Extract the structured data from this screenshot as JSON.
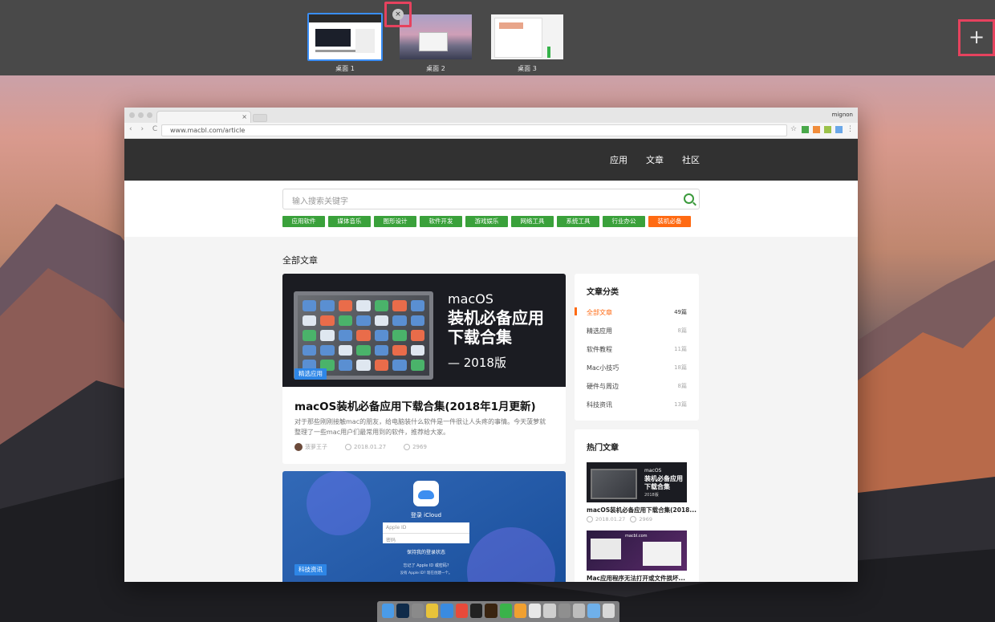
{
  "spaces": [
    {
      "label": "桌面 1",
      "active": true
    },
    {
      "label": "桌面 2",
      "active": false
    },
    {
      "label": "桌面 3",
      "active": false
    }
  ],
  "spaces_add": "+",
  "spaces_close": "×",
  "browser": {
    "tab_title": "",
    "tab_close": "×",
    "user_name": "mignon",
    "nav_buttons": "‹ › C",
    "url": "www.macbl.com/article"
  },
  "site_nav": [
    "应用",
    "文章",
    "社区"
  ],
  "search": {
    "placeholder": "输入搜索关键字"
  },
  "categories": [
    "应用软件",
    "媒体音乐",
    "图形设计",
    "软件开发",
    "游戏娱乐",
    "网络工具",
    "系统工具",
    "行业办公",
    "装机必备"
  ],
  "section_heading": "全部文章",
  "article": {
    "hero_line1": "macOS",
    "hero_line2": "装机必备应用",
    "hero_line3": "下载合集",
    "hero_line4": "— 2018版",
    "badge": "精选应用",
    "title": "macOS装机必备应用下载合集(2018年1月更新)",
    "excerpt": "对于那些刚刚接触mac的朋友，给电脑装什么软件是一件很让人头疼的事情。今天菠萝就整理了一些mac用户们最常用到的软件，推荐给大家。",
    "author": "菠萝王子",
    "date": "2018.01.27",
    "views": "2969"
  },
  "article2": {
    "badge": "科技资讯",
    "icloud_title": "登录 iCloud",
    "apple_id": "Apple ID",
    "password": "密码",
    "keep_signed": "保持我的登录状态",
    "forgot": "忘记了 Apple ID 或密码?",
    "create": "没有 Apple ID? 现在创建一个。"
  },
  "category_panel": {
    "title": "文章分类",
    "rows": [
      {
        "name": "全部文章",
        "count": "49篇"
      },
      {
        "name": "精选应用",
        "count": "8篇"
      },
      {
        "name": "软件教程",
        "count": "11篇"
      },
      {
        "name": "Mac小技巧",
        "count": "18篇"
      },
      {
        "name": "硬件与周边",
        "count": "8篇"
      },
      {
        "name": "科技资讯",
        "count": "13篇"
      }
    ]
  },
  "hot_panel": {
    "title": "热门文章",
    "items": [
      {
        "img_l1": "macOS",
        "img_l2": "装机必备应用",
        "img_l3": "下载合集",
        "img_l4": "2018版",
        "title": "macOS装机必备应用下载合集(2018...",
        "date": "2018.01.27",
        "views": "2969"
      },
      {
        "img_url": "macbl.com",
        "title": "Mac应用程序无法打开或文件损坏..."
      }
    ]
  },
  "colors": {
    "accent_green": "#3aa13b",
    "accent_orange": "#ff6a12",
    "badge_blue": "#2e86e6",
    "highlight_red": "#e6425e",
    "active_space": "#3a8ef6"
  }
}
